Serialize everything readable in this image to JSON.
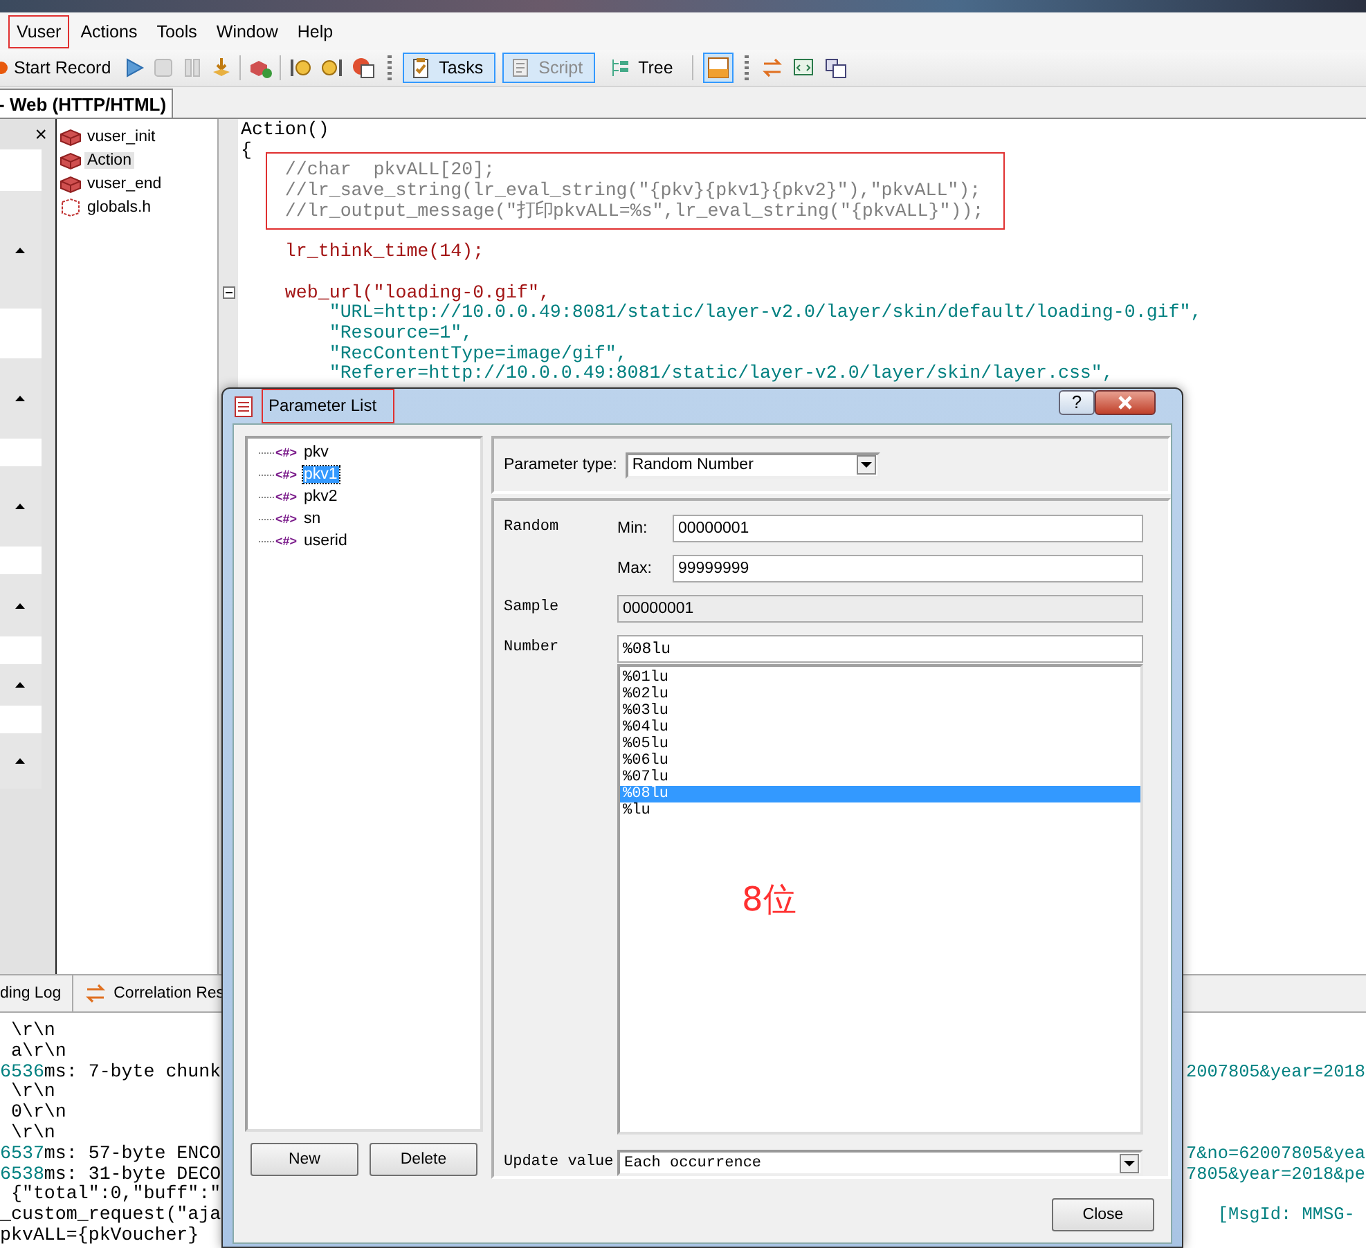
{
  "menu": [
    {
      "label": "Vuser",
      "annotated": true
    },
    {
      "label": "Actions",
      "annotated": false
    },
    {
      "label": "Tools",
      "annotated": false
    },
    {
      "label": "Window",
      "annotated": false
    },
    {
      "label": "Help",
      "annotated": false
    }
  ],
  "toolbar": {
    "record_label": "Start Record",
    "toggles": [
      {
        "label": "Tasks",
        "pressed": true,
        "disabled": false
      },
      {
        "label": "Script",
        "pressed": true,
        "disabled": true
      },
      {
        "label": "Tree",
        "pressed": false,
        "disabled": false
      }
    ]
  },
  "document_tab": {
    "label": "- Web (HTTP/HTML)"
  },
  "side_panel": {
    "close": "×"
  },
  "script_tree": [
    {
      "label": "vuser_init",
      "kind": "action",
      "selected": false
    },
    {
      "label": "Action",
      "kind": "action",
      "selected": true
    },
    {
      "label": "vuser_end",
      "kind": "action",
      "selected": false
    },
    {
      "label": "globals.h",
      "kind": "header",
      "selected": false
    }
  ],
  "code": [
    {
      "text": "Action()",
      "kind": "plain"
    },
    {
      "text": "{",
      "kind": "plain"
    },
    {
      "text": "    //char  pkvALL[20];",
      "kind": "comment"
    },
    {
      "text": "    //lr_save_string(lr_eval_string(\"{pkv}{pkv1}{pkv2}\"),\"pkvALL\");",
      "kind": "comment"
    },
    {
      "text": "    //lr_output_message(\"打印pkvALL=%s\",lr_eval_string(\"{pkvALL}\"));",
      "kind": "comment"
    },
    {
      "kind": "blank"
    },
    {
      "text": "    lr_think_time(14);",
      "kind": "call"
    },
    {
      "kind": "blank"
    },
    {
      "text": "    web_url(\"loading-0.gif\",",
      "kind": "call",
      "fold": true
    },
    {
      "text": "        \"URL=http://10.0.0.49:8081/static/layer-v2.0/layer/skin/default/loading-0.gif\",",
      "kind": "string"
    },
    {
      "text": "        \"Resource=1\",",
      "kind": "string"
    },
    {
      "text": "        \"RecContentType=image/gif\",",
      "kind": "string"
    },
    {
      "text": "        \"Referer=http://10.0.0.49:8081/static/layer-v2.0/layer/skin/layer.css\",",
      "kind": "string"
    }
  ],
  "comment_annotated": true,
  "bottom_tabs": [
    {
      "label": "ding Log"
    },
    {
      "label": "Correlation Res"
    }
  ],
  "log": [
    {
      "text": " \\r\\n"
    },
    {
      "text": " a\\r\\n"
    },
    {
      "time": "6536",
      "text": "ms: 7-byte chunk",
      "right": "2007805&year=2018"
    },
    {
      "text": " \\r\\n"
    },
    {
      "text": " 0\\r\\n"
    },
    {
      "text": " \\r\\n"
    },
    {
      "time": "6537",
      "text": "ms: 57-byte ENCO",
      "right": "7&no=62007805&yea"
    },
    {
      "time": "6538",
      "text": "ms: 31-byte DECO",
      "right": "7805&year=2018&pe"
    },
    {
      "text": " {\"total\":0,\"buff\":\""
    },
    {
      "text": "_custom_request(\"aja",
      "right": "   [MsgId: MMSG-"
    },
    {
      "text": "pkvALL={pkVoucher}"
    }
  ],
  "dialog": {
    "title": "Parameter List",
    "annotated": true,
    "help": "?",
    "parameters": [
      {
        "tag": "<#>",
        "label": "pkv",
        "selected": false
      },
      {
        "tag": "<#>",
        "label": "pkv1",
        "selected": true
      },
      {
        "tag": "<#>",
        "label": "pkv2",
        "selected": false
      },
      {
        "tag": "<#>",
        "label": "sn",
        "selected": false
      },
      {
        "tag": "<#>",
        "label": "userid",
        "selected": false
      }
    ],
    "new_button": "New",
    "delete_button": "Delete",
    "type_label": "Parameter type:",
    "type_value": "Random Number",
    "random_label": "Random",
    "min_label": "Min:",
    "min_value": "00000001",
    "max_label": "Max:",
    "max_value": "99999999",
    "sample_label": "Sample",
    "sample_value": "00000001",
    "number_label": "Number",
    "number_value": "%08lu",
    "formats": [
      {
        "label": "%01lu",
        "selected": false
      },
      {
        "label": "%02lu",
        "selected": false
      },
      {
        "label": "%03lu",
        "selected": false
      },
      {
        "label": "%04lu",
        "selected": false
      },
      {
        "label": "%05lu",
        "selected": false
      },
      {
        "label": "%06lu",
        "selected": false
      },
      {
        "label": "%07lu",
        "selected": false
      },
      {
        "label": "%08lu",
        "selected": true
      },
      {
        "label": "%lu",
        "selected": false
      }
    ],
    "note": "8位",
    "update_label": "Update value",
    "update_value": "Each occurrence",
    "close_button": "Close"
  }
}
